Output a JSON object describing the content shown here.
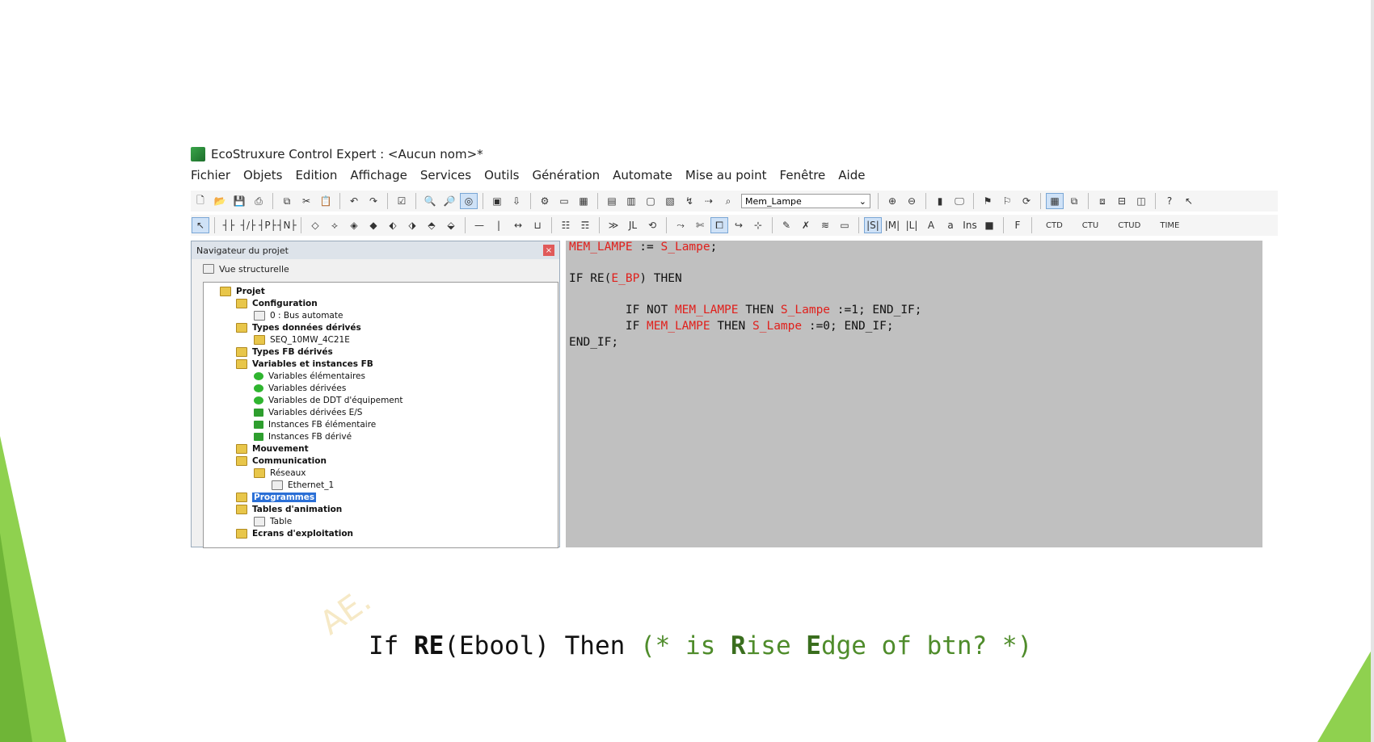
{
  "colors": {
    "accent_green": "#8fd14f",
    "code_red": "#e0201c",
    "editor_bg": "#c0c0c0",
    "comment_green": "#4f8c2b"
  },
  "window": {
    "title": "EcoStruxure Control Expert : <Aucun nom>*"
  },
  "menu": [
    "Fichier",
    "Objets",
    "Edition",
    "Affichage",
    "Services",
    "Outils",
    "Génération",
    "Automate",
    "Mise au point",
    "Fenêtre",
    "Aide"
  ],
  "toolbar": {
    "search_value": "Mem_Lampe",
    "btn_ins": "Ins",
    "btn_f": "F",
    "labels": [
      "CTD",
      "CTU",
      "CTUD",
      "TIME"
    ]
  },
  "navigator": {
    "title": "Navigateur du projet",
    "view": "Vue structurelle",
    "tree": [
      {
        "label": "Projet",
        "bold": true
      },
      {
        "label": "Configuration",
        "bold": true
      },
      {
        "label": "0 : Bus automate",
        "bold": false
      },
      {
        "label": "Types données dérivés",
        "bold": true
      },
      {
        "label": "SEQ_10MW_4C21E",
        "bold": false
      },
      {
        "label": "Types FB dérivés",
        "bold": true
      },
      {
        "label": "Variables et instances FB",
        "bold": true
      },
      {
        "label": "Variables élémentaires",
        "bold": false
      },
      {
        "label": "Variables dérivées",
        "bold": false
      },
      {
        "label": "Variables de DDT d'équipement",
        "bold": false
      },
      {
        "label": "Variables dérivées E/S",
        "bold": false
      },
      {
        "label": "Instances FB élémentaire",
        "bold": false
      },
      {
        "label": "Instances FB dérivé",
        "bold": false
      },
      {
        "label": "Mouvement",
        "bold": true
      },
      {
        "label": "Communication",
        "bold": true
      },
      {
        "label": "Réseaux",
        "bold": false
      },
      {
        "label": "Ethernet_1",
        "bold": false
      },
      {
        "label": "Programmes",
        "bold": true
      },
      {
        "label": "Tables d'animation",
        "bold": true
      },
      {
        "label": "Table",
        "bold": false
      },
      {
        "label": "Ecrans d'exploitation",
        "bold": true
      }
    ]
  },
  "code": {
    "l1a": "MEM_LAMPE",
    "l1b": " := ",
    "l1c": "S_Lampe",
    "l1d": ";",
    "l2a": "IF RE(",
    "l2b": "E_BP",
    "l2c": ") THEN",
    "l3a": "        IF NOT ",
    "l3b": "MEM_LAMPE",
    "l3c": " THEN ",
    "l3d": "S_Lampe",
    "l3e": " :=1; END_IF;",
    "l4a": "        IF ",
    "l4b": "MEM_LAMPE",
    "l4c": " THEN ",
    "l4d": "S_Lampe",
    "l4e": " :=0; END_IF;",
    "l5": "END_IF;"
  },
  "caption": {
    "c1": "If ",
    "c2": "RE",
    "c3": "(Ebool) Then ",
    "c4": "(* is ",
    "c5": "R",
    "c6": "ise ",
    "c7": "E",
    "c8": "dge of btn? *)"
  },
  "watermark": "AE."
}
